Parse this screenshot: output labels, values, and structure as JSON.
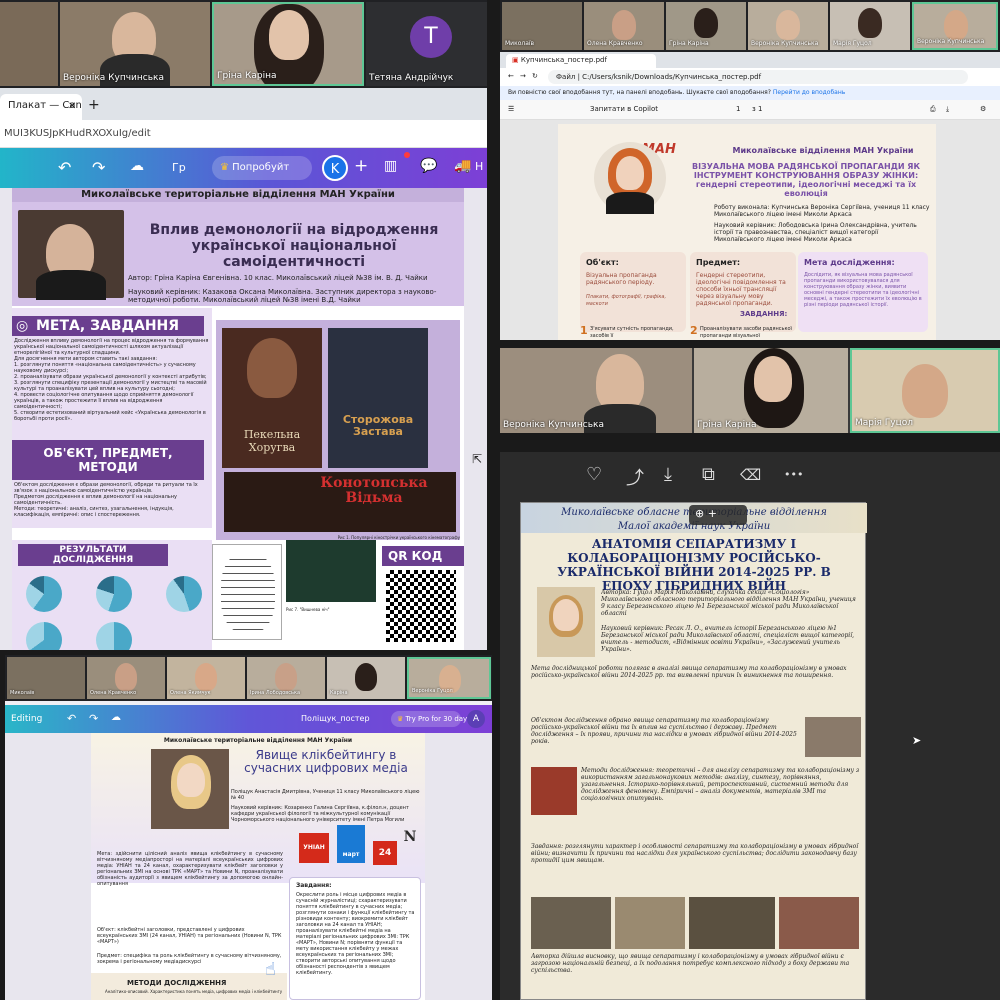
{
  "paneA": {
    "participants": [
      {
        "name": "Вероніка Купчинська"
      },
      {
        "name": "Гріна Каріна"
      },
      {
        "name": "Тетяна Андрійчук",
        "initial": "T"
      }
    ],
    "tab_title": "Плакат — Canv",
    "url": "MUI3KUSJpKHudRXOXuIg/edit",
    "toolbar": {
      "undo": "↶",
      "redo": "↷",
      "cloud": "☁",
      "partial_label": "Гр",
      "try_label": "Попробуйт",
      "avatar": "K",
      "plus": "+",
      "more": "Н"
    },
    "poster": {
      "org": "Миколаївське територіальне відділення МАН України",
      "title": "Вплив демонології на відродження української національної самоідентичності",
      "author": "Автор: Гріна Каріна Євгенівна. 10 клас. Миколаївський ліцей №38 ім. В. Д. Чайки",
      "advisor": "Науковий керівник: Казакова Оксана Миколаївна. Заступник директора з науково-методичної роботи. Миколаївський ліцей №38 імені В.Д. Чайки",
      "section1": "МЕТА, ЗАВДАННЯ",
      "section2": "ОБ'ЄКТ, ПРЕДМЕТ, МЕТОДИ",
      "section3": "РЕЗУЛЬТАТИ ДОСЛІДЖЕННЯ",
      "section4": "QR КОД",
      "movie1": "Пекельна Хоругва",
      "movie2": "Сторожова Застава",
      "movie3": "Конотопська Відьма",
      "caption1": "Рис 1. Популярні кінострічки українського кінематографу",
      "caption2": "Рис 7. \"Вишнева ніч\"",
      "body1": "Дослідження впливу демонології на процес відродження та формування української національної самоідентичності шляхом актуалізації етнорелігійної та культурної спадщини.\nДля досягнення мети автором ставить такі завдання:\n1. розглянути поняття «національна самоідентичність» у сучасному науковому дискурсі;\n2. проаналізувати образи української демонології у контексті атрибутів;\n3. розглянути специфіку презентації демонології у мистецтві та масовій культурі та проаналізувати цей вплив на культуру сьогодні;\n4. провести соціологічне опитування щодо сприйняття демонології українців, а також простежити її вплив на відродження самоідентичності;\n5. створити естетизований віртуальний кейс «Українська демонологія в боротьбі проти росії».",
      "body2": "Об'єктом дослідження є образи демонології, обряди та ритуали та їх зв'язок з національною самоідентичністю українців.\nПредметом дослідження є вплив демонології на національну самоідентичність.\nМетоди: теоретичні: аналіз, синтез, узагальнення, індукція, класифікація, емпіричні: опис і спостереження."
    }
  },
  "paneB": {
    "participants": [
      {
        "name": "Миколаїв"
      },
      {
        "name": "Олена Кравченко"
      },
      {
        "name": "Гріна Каріна"
      },
      {
        "name": "Вероніка Купчинська"
      },
      {
        "name": "Марія Гуцол"
      },
      {
        "name": "Вероніка Купчинська"
      }
    ],
    "tab_title": "Купчинська_постер.pdf",
    "address_label": "Файл",
    "address": "C:/Users/ksnik/Downloads/Купчинська_постер.pdf",
    "infobar": "Ви повністю свої вподобання тут, на панелі вподобань. Шукаєте свої вподобання?",
    "infobar_link": "Перейти до вподобань",
    "pdf_toolbar": {
      "menu": "Запитати в Copilot",
      "page": "1",
      "of": "з 1"
    },
    "poster": {
      "logo": "МАН",
      "org": "Миколаївське відділення МАН України",
      "title": "ВІЗУАЛЬНА МОВА РАДЯНСЬКОЇ ПРОПАГАНДИ ЯК ІНСТРУМЕНТ КОНСТРУЮВАННЯ ОБРАЗУ ЖІНКИ: гендерні стереотипи, ідеологічні меседжі та їх еволюція",
      "author": "Роботу виконала: Купчинська Вероніка Сергіївна, учениця 11 класу Миколаївського ліцею імені Миколи Аркаса",
      "advisor": "Науковий керівник: Лободовська Ірина Олександрівна, учитель історії та правознавства, спеціаліст вищої категорії Миколаївського ліцею імені Миколи Аркаса",
      "col1_title": "Об'єкт:",
      "col1_body": "Візуальна пропаганда радянського періоду.",
      "col1_note": "Плакати, фотографії, графіка, маскоти",
      "col2_title": "Предмет:",
      "col2_body": "Гендерні стереотипи, ідеологічні повідомлення та способи їхньої трансляції через візуальну мову радянської пропаганди.",
      "col3_title": "Мета дослідження:",
      "col3_body": "Дослідити, як візуальна мова радянської пропаганди використовувалася для конструювання образу жінки, виявити основні гендерні стереотипи та ідеологічні меседжі, а також простежити їх еволюцію в різні періоди радянської історії.",
      "tasks_label": "ЗАВДАННЯ:",
      "task1_num": "1",
      "task1": "З'ясувати сутність пропаганди, засобів її",
      "task2_num": "2",
      "task2": "Проаналізувати засоби радянської пропаганди візуальної"
    }
  },
  "paneC": {
    "participants": [
      {
        "name": "Вероніка Купчинська"
      },
      {
        "name": "Гріна Каріна"
      },
      {
        "name": "Марія Гуцол"
      }
    ]
  },
  "paneD": {
    "toolbar": {
      "heart": "♡",
      "share": "⤴",
      "download": "⤓",
      "copy": "⧉",
      "trash": "🗑",
      "more": "•••"
    },
    "zoom": {
      "in": "⊕",
      "plus": "+"
    },
    "poster": {
      "org1": "Миколаївське обласне територіальне відділення",
      "org2": "Малої академії наук України",
      "title": "АНАТОМІЯ СЕПАРАТИЗМУ І КОЛАБОРАЦІОНІЗМУ РОСІЙСЬКО-УКРАЇНСЬКОЇ ВІЙНИ 2014-2025 РР. В ЕПОХУ ГІБРИДНИХ ВІЙН",
      "author": "Авторка: Гуцол Марія Миколаївна, слухачка секції «Соціологія» Миколаївського обласного територіального відділення МАН України, учениця 9 класу Березанського ліцею №1 Березанської міської ради Миколаївської області",
      "advisor": "Науковий керівник: Ресак Л. О., вчитель історії Березанського ліцею №1 Березанської міської ради Миколаївської області, спеціаліст вищої категорії, вчитель - методист, «Відмінник освіти України», «Заслужений учитель України».",
      "meta": "Мета дослідницької роботи полягає в аналізі явища сепаратизму та колабораціонізму в умовах російсько-української війни 2014-2025 рр. та виявленні причин їх виникнення та поширення.",
      "object": "Об'єктом дослідження обрано явища сепаратизму та колабораціонізму російсько-української війни та їх вплив на суспільство і державу. Предмет дослідження – їх прояви, причини та наслідки в умовах гібридної війни 2014-2025 років.",
      "methods": "Методи дослідження: теоретичні – для аналізу сепаратизму та колабораціонізму з використанням загальнонаукових методів: аналізу, синтезу, порівняння, узагальнення. Історико-порівняльний, ретроспективний, системний методи для дослідження феномену. Емпіричні – аналіз документів, матеріалів ЗМІ та соціологічних опитувань.",
      "tasks": "Завдання: розглянути характер і особливості сепаратизму та колабораціонізму в умовах гібридної війни; визначити їх причини та наслідки для українського суспільства; дослідити законодавчу базу протидії цим явищам.",
      "footer": "Авторка дійшла висновку, що явища сепаратизму і колабораціонізму в умовах гібридної війни є загрозою національній безпеці, а їх подолання потребує комплексного підходу з боку держави та суспільства."
    }
  },
  "paneE": {
    "participants": [
      {
        "name": "Миколаїв"
      },
      {
        "name": "Олена Кравченко"
      },
      {
        "name": "Олена Якимчук"
      },
      {
        "name": "Ірина Лободовська"
      },
      {
        "name": "Каріна"
      },
      {
        "name": "Вероніка Гуцол"
      }
    ],
    "toolbar": {
      "editing": "Editing",
      "file": "Поліщук_постер",
      "try_pro": "Try Pro for 30 days",
      "avatar": "A"
    },
    "poster": {
      "org": "Миколаївське територіальне відділення МАН України",
      "title": "Явище клікбейтингу в сучасних цифрових медіа",
      "author": "Поліщук Анастасія Дмитрівна, Учениця 11 класу Миколаївського ліцею № 40",
      "advisor": "Науковий керівник: Козаренко Галина Сергіївна, к.філол.н, доцент кафедри української філології та міжкультурної комунікації Чорноморського національного університету імені Петра Могили",
      "meta": "Мета: здійснити цілісний аналіз явища клікбейтингу в сучасному вітчизняному медіапросторі на матеріалі всеукраїнських цифрових медіа: УНІАН та 24 канал, охарактеризувати клікбейт заголовки у регіональних ЗМІ на основі ТРК «МАРТ» та Новини N, проаналізувати обізнаність аудиторії з явищем клікбейтингу за допомогою онлайн-опитування",
      "object": "Об'єкт: клікбейтні заголовки, представлені у цифрових всеукраїнських ЗМІ (24 канал, УНІАН) та регіональних (Новини N, ТРК «МАРТ»)",
      "subject": "Предмет: специфіка та роль клікбейтингу в сучасному вітчизняному, зокрема і регіональному медіадискурсі",
      "methods_title": "МЕТОДИ ДОСЛІДЖЕННЯ",
      "method1": "Аналітико-описовий. Характеристика понять медіа, цифрових медіа і клікбейтингу",
      "tasks_title": "Завдання:",
      "tasks": "Окреслити роль і місце цифрових медіа в сучасній журналістиці; схарактеризувати поняття клікбейтингу в сучасних медіа; розглянути ознаки і функції клікбейтингу та різновиди контенту; виокремити клікбейт заголовки на 24 канал та УНІАН; проаналізувати клікбейтні медіа на матеріалі регіональних цифрових ЗМІ: ТРК «МАРТ», Новини N; порівняти функції та мету використання клікбейту у межах всеукраїнських та регіональних ЗМІ; створити авторські опитування щодо обізнаності респондентів з явищем клікбейтингу.",
      "logo1": "УНІАН",
      "logo2": "март",
      "logo3": "24",
      "logo4": "N"
    }
  }
}
